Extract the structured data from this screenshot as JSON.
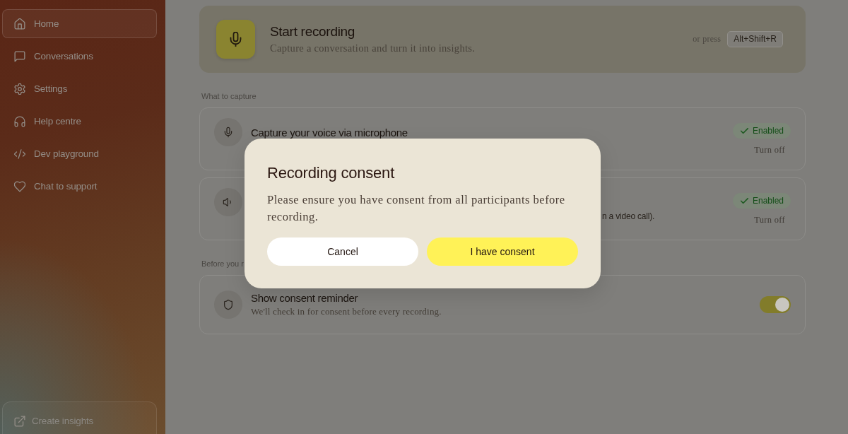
{
  "sidebar": {
    "items": [
      {
        "label": "Home",
        "selected": true
      },
      {
        "label": "Conversations",
        "selected": false
      },
      {
        "label": "Settings",
        "selected": false
      },
      {
        "label": "Help centre",
        "selected": false
      },
      {
        "label": "Dev playground",
        "selected": false
      },
      {
        "label": "Chat to support",
        "selected": false
      }
    ],
    "footer_link": {
      "label": "Create insights"
    }
  },
  "start_recording": {
    "title": "Start recording",
    "subtitle": "Capture a conversation and turn it into insights.",
    "shortcut_hint": "or press",
    "shortcut": "Alt+Shift+R"
  },
  "sections": [
    {
      "label": "What to capture",
      "cards": [
        {
          "kind": "source",
          "title": "Capture your voice via microphone",
          "on": true,
          "status": "Enabled",
          "action": "Turn off"
        },
        {
          "kind": "source",
          "description": "n a video call).",
          "on": true,
          "status": "Enabled",
          "action": "Turn off"
        }
      ]
    },
    {
      "label": "Before you r",
      "cards": [
        {
          "kind": "toggle",
          "title": "Show consent reminder",
          "description": "We'll check in for consent before every recording.",
          "on": true
        }
      ]
    }
  ],
  "dialog": {
    "title": "Recording consent",
    "message": "Please ensure you have consent from all participants before recording.",
    "buttons": [
      {
        "label": "Cancel",
        "kind": "secondary"
      },
      {
        "label": "I have consent",
        "kind": "primary"
      }
    ]
  }
}
